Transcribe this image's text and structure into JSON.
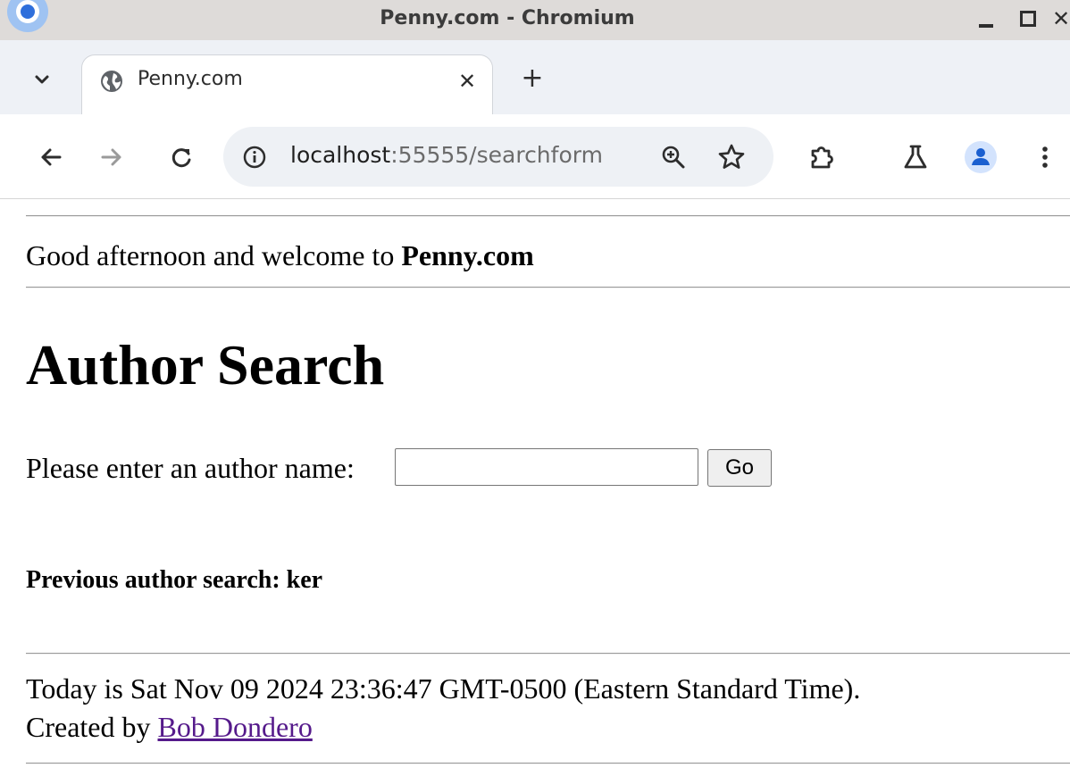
{
  "window": {
    "title": "Penny.com - Chromium",
    "close_glyph": "✕"
  },
  "tab": {
    "title": "Penny.com",
    "close_glyph": "✕"
  },
  "new_tab_glyph": "+",
  "address_bar": {
    "host": "localhost",
    "rest": ":55555/searchform"
  },
  "page": {
    "greeting_prefix": "Good afternoon and welcome to ",
    "greeting_site": "Penny.com",
    "heading": "Author Search",
    "prompt_label": "Please enter an author name:",
    "author_input_value": "",
    "go_label": "Go",
    "previous_search": "Previous author search: ker",
    "date_line": "Today is Sat Nov 09 2024 23:36:47 GMT-0500 (Eastern Standard Time).",
    "created_by_prefix": "Created by ",
    "author_link": "Bob Dondero"
  },
  "colors": {
    "link_visited": "#551a8b",
    "avatar_blue": "#1a5fd0",
    "titlebar": "#dedbd9"
  }
}
